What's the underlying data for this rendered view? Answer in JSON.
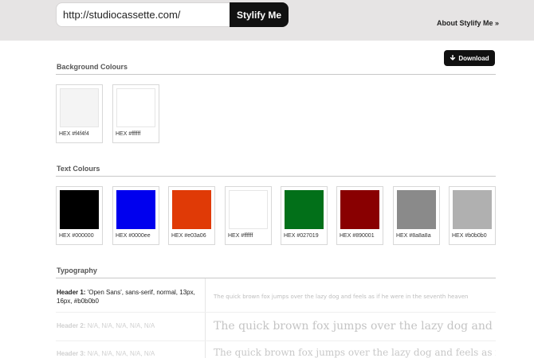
{
  "header": {
    "url_value": "http://studiocassette.com/",
    "stylify_label": "Stylify Me",
    "about_label": "About Stylify Me »"
  },
  "download_label": "Download",
  "background_colours": {
    "title": "Background Colours",
    "swatches": [
      {
        "hex": "#f4f4f4",
        "label": "HEX #f4f4f4"
      },
      {
        "hex": "#ffffff",
        "label": "HEX #ffffff"
      }
    ]
  },
  "text_colours": {
    "title": "Text Colours",
    "swatches": [
      {
        "hex": "#000000",
        "label": "HEX #000000"
      },
      {
        "hex": "#0000ee",
        "label": "HEX #0000ee"
      },
      {
        "hex": "#e03a06",
        "label": "HEX #e03a06"
      },
      {
        "hex": "#ffffff",
        "label": "HEX #ffffff"
      },
      {
        "hex": "#027019",
        "label": "HEX #027019"
      },
      {
        "hex": "#890001",
        "label": "HEX #890001"
      },
      {
        "hex": "#8a8a8a",
        "label": "HEX #8a8a8a"
      },
      {
        "hex": "#b0b0b0",
        "label": "HEX #b0b0b0"
      }
    ]
  },
  "typography": {
    "title": "Typography",
    "rows": [
      {
        "name": "Header 1:",
        "spec": "'Open Sans', sans-serif, normal, 13px, 16px, #b0b0b0",
        "sample": "The quick brown fox jumps over the lazy dog and feels as if he were in the seventh heaven"
      },
      {
        "name": "Header 2:",
        "spec": "N/A, N/A, N/A, N/A, N/A",
        "sample": "The quick brown fox jumps over the lazy dog and feels as if he were in the seventh heaven"
      },
      {
        "name": "Header 3:",
        "spec": "N/A, N/A, N/A, N/A, N/A",
        "sample": "The quick brown fox jumps over the lazy dog and feels as if he were in the seventh heaven"
      }
    ]
  }
}
